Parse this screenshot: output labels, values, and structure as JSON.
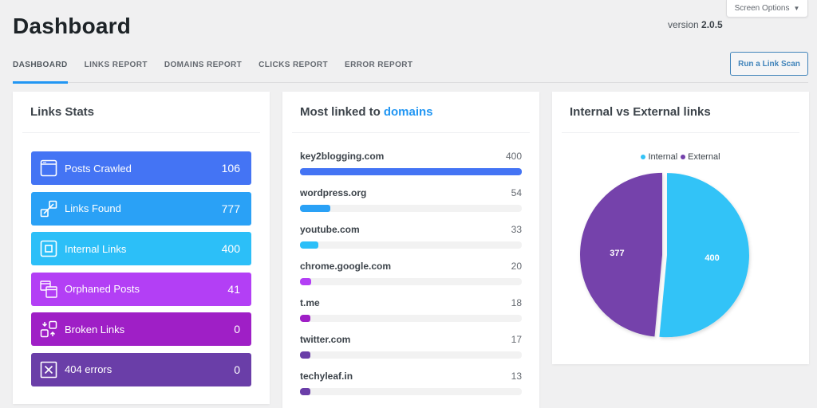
{
  "header": {
    "title": "Dashboard",
    "version_label": "version",
    "version_number": "2.0.5",
    "screen_options": "Screen Options",
    "screen_options_icon": "caret-down-icon"
  },
  "tabs": [
    {
      "label": "DASHBOARD",
      "active": true
    },
    {
      "label": "LINKS REPORT",
      "active": false
    },
    {
      "label": "DOMAINS REPORT",
      "active": false
    },
    {
      "label": "CLICKS REPORT",
      "active": false
    },
    {
      "label": "ERROR REPORT",
      "active": false
    }
  ],
  "actions": {
    "run_scan": "Run a Link Scan"
  },
  "links_stats": {
    "title": "Links Stats",
    "items": [
      {
        "label": "Posts Crawled",
        "value": "106",
        "icon": "browser-window-icon",
        "color": "#4474f4"
      },
      {
        "label": "Links Found",
        "value": "777",
        "icon": "link-connect-icon",
        "color": "#2aa1f6"
      },
      {
        "label": "Internal Links",
        "value": "400",
        "icon": "internal-square-icon",
        "color": "#2cbff8"
      },
      {
        "label": "Orphaned Posts",
        "value": "41",
        "icon": "stacked-windows-icon",
        "color": "#b33ff5"
      },
      {
        "label": "Broken Links",
        "value": "0",
        "icon": "broken-link-icon",
        "color": "#9f1fc6"
      },
      {
        "label": "404 errors",
        "value": "0",
        "icon": "x-box-icon",
        "color": "#6a3ea8"
      }
    ]
  },
  "domains": {
    "title_prefix": "Most linked to",
    "title_accent": "domains",
    "max": 400,
    "items": [
      {
        "name": "key2blogging.com",
        "count": 400,
        "color": "#4474f4"
      },
      {
        "name": "wordpress.org",
        "count": 54,
        "color": "#2aa1f6"
      },
      {
        "name": "youtube.com",
        "count": 33,
        "color": "#2cbff8"
      },
      {
        "name": "chrome.google.com",
        "count": 20,
        "color": "#b33ff5"
      },
      {
        "name": "t.me",
        "count": 18,
        "color": "#9f1fc6"
      },
      {
        "name": "twitter.com",
        "count": 17,
        "color": "#6a3ea8"
      },
      {
        "name": "techyleaf.in",
        "count": 13,
        "color": "#6a3ea8"
      }
    ]
  },
  "chart_data": {
    "type": "pie",
    "title": "Internal vs External links",
    "legend_position": "top-center",
    "categories": [
      "Internal",
      "External"
    ],
    "values": [
      400,
      377
    ],
    "colors": [
      "#33c3f7",
      "#7442ab"
    ],
    "data_labels": [
      "400",
      "377"
    ]
  }
}
